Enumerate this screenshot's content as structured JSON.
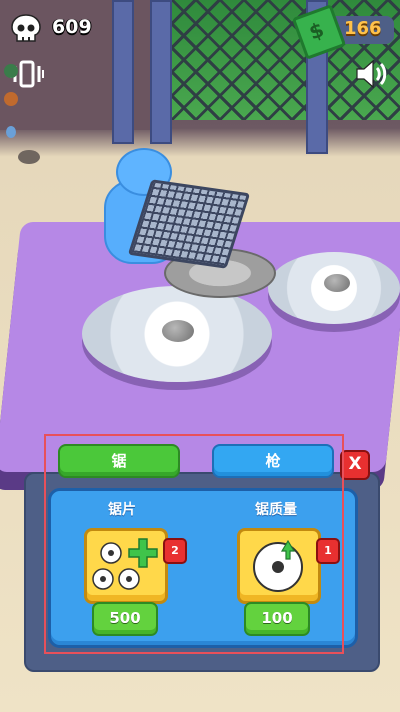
{
  "hud": {
    "kills": "609",
    "money": "166",
    "skull_icon": "skull-icon",
    "money_icon": "cash-icon",
    "vibration_icon": "vibration-icon",
    "sound_icon": "speaker-icon"
  },
  "tabs": {
    "saw_label": "锯",
    "gun_label": "枪",
    "close_label": "X"
  },
  "upgrades": [
    {
      "title": "锯片",
      "level": "2",
      "price": "500",
      "icon": "add-saw-blades-icon"
    },
    {
      "title": "锯质量",
      "level": "1",
      "price": "100",
      "icon": "saw-quality-upgrade-icon"
    }
  ],
  "colors": {
    "active_tab": "#4bc83a",
    "inactive_tab": "#33a7f2",
    "panel": "#3ca0ee",
    "price_button": "#63d23e",
    "money_text": "#ffc24a",
    "badge": "#e83030"
  }
}
